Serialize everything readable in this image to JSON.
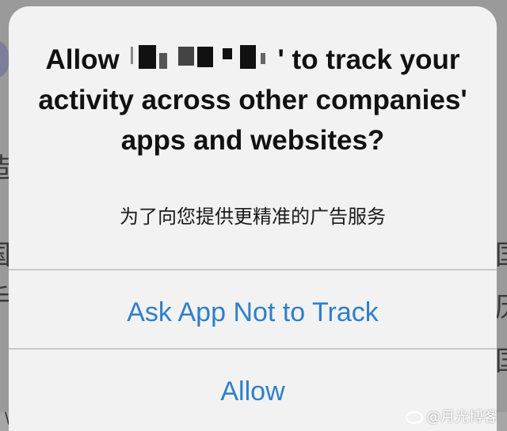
{
  "dialog": {
    "title_prefix": "Allow",
    "title_suffix": "' to track your activity across other companies' apps and websites?",
    "subtitle": "为了向您提供更精准的广告服务",
    "buttons": [
      {
        "label": "Ask App Not to Track"
      },
      {
        "label": "Allow"
      }
    ],
    "accent_color": "#2f7fc8"
  },
  "watermark": {
    "text": "@月光博客"
  }
}
